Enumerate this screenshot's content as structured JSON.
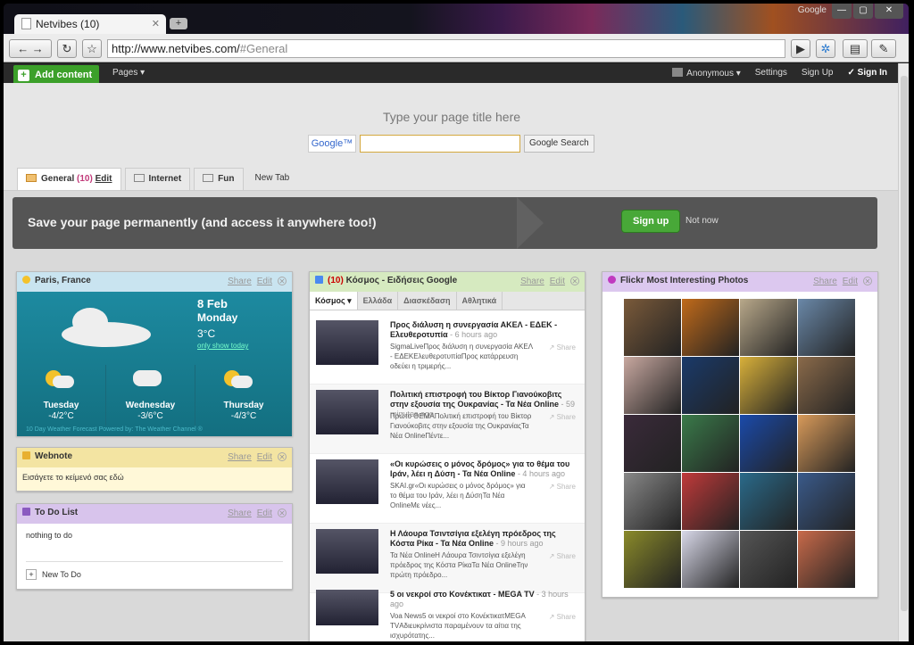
{
  "browser": {
    "tab_title": "Netvibes (10)",
    "url_host": "http://www.netvibes.com/",
    "url_path": "#General",
    "google_label": "Google"
  },
  "topbar": {
    "add_content": "Add content",
    "pages": "Pages ▾",
    "anonymous": "Anonymous ▾",
    "settings": "Settings",
    "sign_up": "Sign Up",
    "sign_in": "Sign In"
  },
  "header": {
    "page_title": "Type your page title here",
    "google_logo": "Google™",
    "google_search": "Google Search"
  },
  "page_tabs": [
    {
      "label": "General",
      "count": "(10)",
      "edit": "Edit"
    },
    {
      "label": "Internet"
    },
    {
      "label": "Fun"
    },
    {
      "label": "New Tab"
    }
  ],
  "banner": {
    "text": "Save your page permanently (and access it anywhere too!)",
    "sign_up": "Sign up",
    "not_now": "Not now"
  },
  "weather": {
    "title": "Paris, France",
    "share": "Share",
    "edit": "Edit",
    "date": "8 Feb",
    "day": "Monday",
    "temp": "3°C",
    "show_today": "only show today",
    "forecast": [
      {
        "day": "Tuesday",
        "temp": "-4/2°C"
      },
      {
        "day": "Wednesday",
        "temp": "-3/6°C"
      },
      {
        "day": "Thursday",
        "temp": "-4/3°C"
      }
    ],
    "footer": "10 Day Weather Forecast   Powered by: The Weather Channel ®"
  },
  "webnote": {
    "title": "Webnote",
    "share": "Share",
    "edit": "Edit",
    "text": "Εισάγετε το κείμενό σας εδώ"
  },
  "todo": {
    "title": "To Do List",
    "share": "Share",
    "edit": "Edit",
    "empty": "nothing to do",
    "new": "New To Do"
  },
  "news": {
    "count": "(10)",
    "title": "Κόσμος - Ειδήσεις Google",
    "share": "Share",
    "edit": "Edit",
    "tabs": [
      "Κόσμος",
      "Ελλάδα",
      "Διασκέδαση",
      "Αθλητικά"
    ],
    "items": [
      {
        "title": "Προς διάλυση η συνεργασία ΑΚΕΛ - ΕΔΕΚ - Ελευθεροτυπία",
        "time": " - 6 hours ago",
        "snippet": "SigmaLiveΠρος διάλυση η συνεργασία ΑΚΕΛ - ΕΔΕΚΕλευθεροτυπίαΠρος κατάρρευση οδεύει η τριμερής...",
        "share": "Share"
      },
      {
        "title": "Πολιτική επιστροφή του Βίκτορ Γιανούκοβιτς στην εξουσία της Ουκρανίας - Τα Νέα Online",
        "time": " - 59 minutes ago",
        "snippet": "Πρώτο ΘΕΜΑΠολιτική επιστροφή του Βίκτορ Γιανούκοβιτς στην εξουσία της ΟυκρανίαςΤα Νέα OnlineΠέντε...",
        "share": "Share"
      },
      {
        "title": "«Οι κυρώσεις ο μόνος δρόμος» για το θέμα του Ιράν, λέει η Δύση - Τα Νέα Online",
        "time": " - 4 hours ago",
        "snippet": "SKAI.gr«Οι κυρώσεις ο μόνος δρόμος» για το θέμα του Ιράν, λέει η ΔύσηΤα Νέα OnlineΜε νέες...",
        "share": "Share"
      },
      {
        "title": "Η Λάουρα Τσιντσίγια εξελέγη πρόεδρος της Κόστα Ρίκα - Τα Νέα Online",
        "time": " - 9 hours ago",
        "snippet": "Τα Νέα OnlineΗ Λάουρα Τσιντσίγια εξελέγη πρόεδρος της Κόστα ΡίκαΤα Νέα OnlineΤην πρώτη πρόεδρο...",
        "share": "Share"
      },
      {
        "title": "5 οι νεκροί στο Κονέκτικατ - MEGA TV",
        "time": " - 3 hours ago",
        "snippet": "Voa News5 οι νεκροί στο ΚονέκτικατMEGA TVΑδιευκρίνιστα παραμένουν τα αίτια της ισχυρότατης...",
        "share": "Share"
      }
    ]
  },
  "flickr": {
    "title": "Flickr Most Interesting Photos",
    "share": "Share",
    "edit": "Edit",
    "photos": [
      "#7a5a3a",
      "#c06a1a",
      "#b8a88a",
      "#6a88a8",
      "#c8a8a0",
      "#1a3a6a",
      "#d8b03a",
      "#8a6a4a",
      "#3a2a3a",
      "#3a7a4a",
      "#1a4aaa",
      "#d89a5a",
      "#888888",
      "#c03a3a",
      "#2a6a8a",
      "#3a5a8a",
      "#8a8a2a",
      "#d8d8e8",
      "#555555",
      "#c86a4a"
    ]
  }
}
